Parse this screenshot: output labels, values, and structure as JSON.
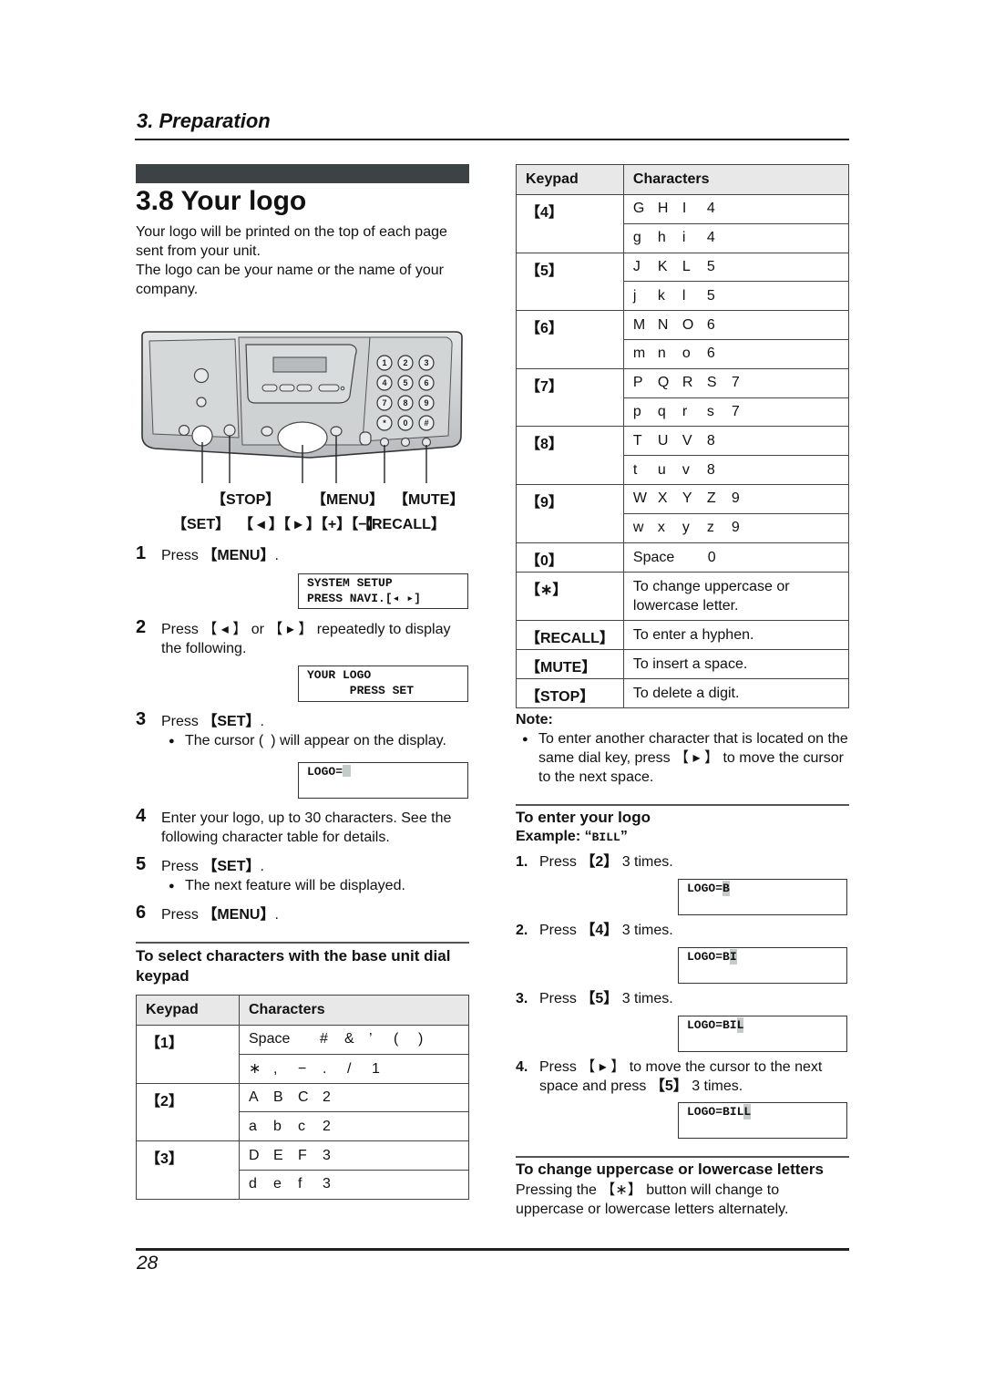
{
  "header": {
    "section": "3. Preparation"
  },
  "title": "3.8 Your logo",
  "intro": [
    "Your logo will be printed on the top of each page sent from your unit.",
    "The logo can be your name or the name of your company."
  ],
  "illustration": {
    "labels": {
      "stop": "【STOP】",
      "menu": "【MENU】",
      "mute": "【MUTE】",
      "set": "【SET】",
      "navi": "【 ◂ 】【 ▸ 】【+】【−】",
      "recall": "【RECALL】"
    },
    "keypad": [
      "1",
      "2",
      "3",
      "4",
      "5",
      "6",
      "7",
      "8",
      "9",
      "*",
      "0",
      "#"
    ]
  },
  "steps": [
    {
      "num": "1",
      "pre": "Press ",
      "key": "【MENU】",
      "post": ".",
      "lcd": [
        "SYSTEM SETUP",
        "PRESS NAVI.[◂ ▸]"
      ]
    },
    {
      "num": "2",
      "text": "Press 【 ◂ 】 or 【 ▸ 】 repeatedly to display the following.",
      "lcd": [
        "YOUR LOGO",
        "      PRESS SET"
      ]
    },
    {
      "num": "3",
      "pre": "Press ",
      "key": "【SET】",
      "post": ".",
      "bullet": "The cursor ( ) will appear on the display.",
      "lcd_prefix": "LOGO="
    },
    {
      "num": "4",
      "text": "Enter your logo, up to 30 characters. See the following character table for details."
    },
    {
      "num": "5",
      "pre": "Press ",
      "key": "【SET】",
      "post": ".",
      "bullet": "The next feature will be displayed."
    },
    {
      "num": "6",
      "pre": "Press ",
      "key": "【MENU】",
      "post": "."
    }
  ],
  "select_heading": "To select characters with the base unit dial keypad",
  "table_headers": {
    "keypad": "Keypad",
    "characters": "Characters"
  },
  "table_left": [
    {
      "key": "【1】",
      "rows": [
        [
          "Space",
          "#",
          "&",
          "’",
          "(",
          ")"
        ],
        [
          "∗",
          ",",
          "−",
          ".",
          "/",
          "1"
        ]
      ]
    },
    {
      "key": "【2】",
      "rows": [
        [
          "A",
          "B",
          "C",
          "2"
        ],
        [
          "a",
          "b",
          "c",
          "2"
        ]
      ]
    },
    {
      "key": "【3】",
      "rows": [
        [
          "D",
          "E",
          "F",
          "3"
        ],
        [
          "d",
          "e",
          "f",
          "3"
        ]
      ]
    }
  ],
  "table_right": [
    {
      "key": "【4】",
      "rows": [
        [
          "G",
          "H",
          "I",
          "4"
        ],
        [
          "g",
          "h",
          "i",
          "4"
        ]
      ]
    },
    {
      "key": "【5】",
      "rows": [
        [
          "J",
          "K",
          "L",
          "5"
        ],
        [
          "j",
          "k",
          "l",
          "5"
        ]
      ]
    },
    {
      "key": "【6】",
      "rows": [
        [
          "M",
          "N",
          "O",
          "6"
        ],
        [
          "m",
          "n",
          "o",
          "6"
        ]
      ]
    },
    {
      "key": "【7】",
      "rows": [
        [
          "P",
          "Q",
          "R",
          "S",
          "7"
        ],
        [
          "p",
          "q",
          "r",
          "s",
          "7"
        ]
      ]
    },
    {
      "key": "【8】",
      "rows": [
        [
          "T",
          "U",
          "V",
          "8"
        ],
        [
          "t",
          "u",
          "v",
          "8"
        ]
      ]
    },
    {
      "key": "【9】",
      "rows": [
        [
          "W",
          "X",
          "Y",
          "Z",
          "9"
        ],
        [
          "w",
          "x",
          "y",
          "z",
          "9"
        ]
      ]
    },
    {
      "key": "【0】",
      "text": "Space   0"
    },
    {
      "key": "【∗】",
      "text": "To change uppercase or lowercase letter."
    },
    {
      "key": "【RECALL】",
      "text": "To enter a hyphen."
    },
    {
      "key": "【MUTE】",
      "text": "To insert a space."
    },
    {
      "key": "【STOP】",
      "text": "To delete a digit."
    }
  ],
  "note": {
    "label": "Note:",
    "text": "To enter another character that is located on the same dial key, press 【 ▸ 】 to move the cursor to the next space."
  },
  "enter_logo": {
    "heading": "To enter your logo",
    "example_label": "Example: “",
    "example_value": "BILL",
    "example_close": "”",
    "steps": [
      {
        "num": "1.",
        "pre": "Press ",
        "key": "【2】",
        "post": " 3 times.",
        "lcd_text": "LOGO=",
        "lcd_cursor": "B"
      },
      {
        "num": "2.",
        "pre": "Press ",
        "key": "【4】",
        "post": " 3 times.",
        "lcd_text": "LOGO=B",
        "lcd_cursor": "I"
      },
      {
        "num": "3.",
        "pre": "Press ",
        "key": "【5】",
        "post": " 3 times.",
        "lcd_text": "LOGO=BI",
        "lcd_cursor": "L"
      },
      {
        "num": "4.",
        "line1": "Press 【 ▸ 】 to move the cursor to the next",
        "line2_pre": "space and press ",
        "key": "【5】",
        "post": " 3 times.",
        "lcd_text": "LOGO=BIL",
        "lcd_cursor": "L"
      }
    ]
  },
  "case_change": {
    "heading": "To change uppercase or lowercase letters",
    "text": "Pressing the 【∗】 button will change to uppercase or lowercase letters alternately."
  },
  "footer": {
    "page_number": "28"
  }
}
